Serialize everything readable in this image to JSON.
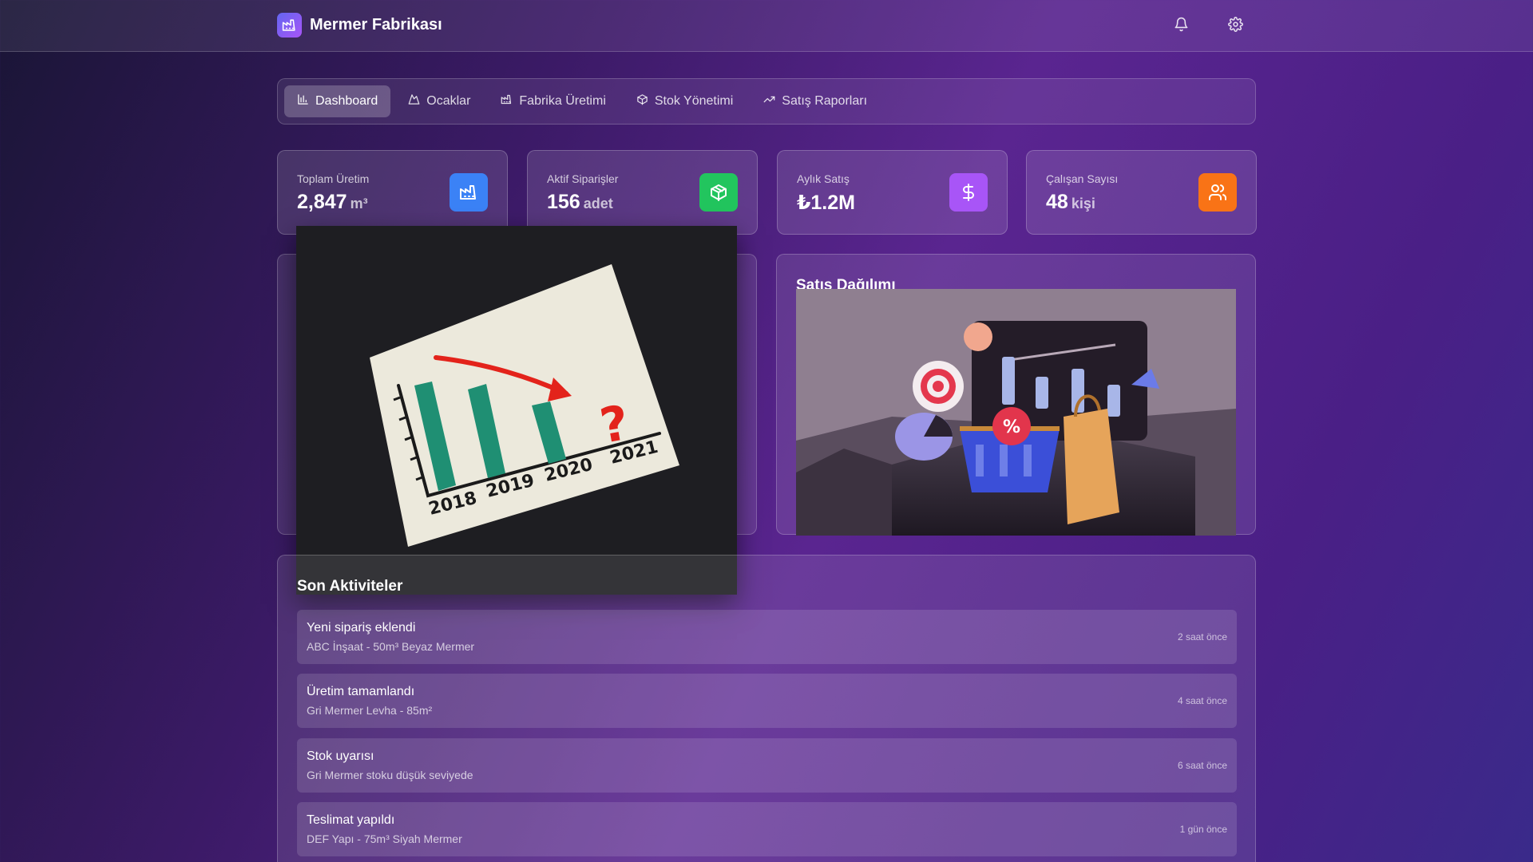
{
  "header": {
    "title": "Mermer Fabrikası",
    "logo_icon": "factory-icon",
    "actions": [
      {
        "icon": "bell-icon"
      },
      {
        "icon": "gear-icon"
      }
    ]
  },
  "nav": {
    "tabs": [
      {
        "label": "Dashboard",
        "icon": "bar-chart-icon",
        "active": true
      },
      {
        "label": "Ocaklar",
        "icon": "mountain-icon",
        "active": false
      },
      {
        "label": "Fabrika Üretimi",
        "icon": "factory-icon",
        "active": false
      },
      {
        "label": "Stok Yönetimi",
        "icon": "package-icon",
        "active": false
      },
      {
        "label": "Satış Raporları",
        "icon": "trending-up-icon",
        "active": false
      }
    ]
  },
  "stats": [
    {
      "label": "Toplam Üretim",
      "value": "2,847",
      "unit": "m³",
      "icon": "factory-icon",
      "color": "#3b82f6"
    },
    {
      "label": "Aktif Siparişler",
      "value": "156",
      "unit": "adet",
      "icon": "package-icon",
      "color": "#22c55e"
    },
    {
      "label": "Aylık Satış",
      "value": "₺1.2M",
      "unit": "",
      "icon": "dollar-icon",
      "color": "#a855f7"
    },
    {
      "label": "Çalışan Sayısı",
      "value": "48",
      "unit": "kişi",
      "icon": "users-icon",
      "color": "#f97316"
    }
  ],
  "panels": {
    "sales_distribution_title": "Satış Dağılımı"
  },
  "images": {
    "trend_years": [
      "2018",
      "2019",
      "2020",
      "2021"
    ]
  },
  "activities": {
    "title": "Son Aktiviteler",
    "items": [
      {
        "title": "Yeni sipariş eklendi",
        "subtitle": "ABC İnşaat - 50m³ Beyaz Mermer",
        "time": "2 saat önce"
      },
      {
        "title": "Üretim tamamlandı",
        "subtitle": "Gri Mermer Levha - 85m²",
        "time": "4 saat önce"
      },
      {
        "title": "Stok uyarısı",
        "subtitle": "Gri Mermer stoku düşük seviyede",
        "time": "6 saat önce"
      },
      {
        "title": "Teslimat yapıldı",
        "subtitle": "DEF Yapı - 75m³ Siyah Mermer",
        "time": "1 gün önce"
      }
    ]
  }
}
